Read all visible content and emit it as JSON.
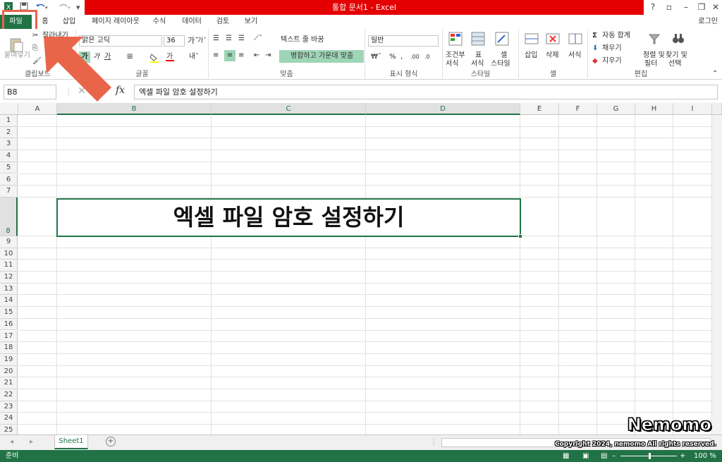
{
  "titlebar": {
    "title": "통합 문서1 - Excel",
    "qa_items": [
      "save-icon",
      "undo-icon",
      "redo-icon",
      "customize-icon"
    ]
  },
  "tabs": {
    "file": "파일",
    "home": "홈",
    "insert": "삽입",
    "layout": "페이지 레이아웃",
    "formulas": "수식",
    "data": "데이터",
    "review": "검토",
    "view": "보기",
    "login": "로그인"
  },
  "ribbon": {
    "clipboard": {
      "paste": "붙여넣기",
      "cut": "잘라내기",
      "label": "클립보드"
    },
    "font": {
      "name": "맑은 고딕",
      "size": "36",
      "label": "글꼴"
    },
    "align": {
      "wrap": "텍스트 줄 바꿈",
      "merge": "병합하고 가운데 맞춤",
      "label": "맞춤"
    },
    "number": {
      "format": "일반",
      "percent": "%",
      "comma": ",",
      "label": "표시 형식"
    },
    "styles": {
      "conditional1": "조건부",
      "conditional2": "서식",
      "table1": "표",
      "table2": "서식",
      "cell1": "셀",
      "cell2": "스타일",
      "label": "스타일"
    },
    "cells": {
      "insert": "삽입",
      "delete": "삭제",
      "format": "서식",
      "label": "셀"
    },
    "editing": {
      "autosum": "자동 합계",
      "fill": "채우기",
      "clear": "지우기",
      "sort1": "정렬 및",
      "sort2": "필터",
      "find1": "찾기 및",
      "find2": "선택",
      "label": "편집"
    }
  },
  "formula_bar": {
    "name_box": "B8",
    "fx": "fx",
    "content": "엑셀 파일 암호 설정하기"
  },
  "columns": [
    "A",
    "B",
    "C",
    "D",
    "E",
    "F",
    "G",
    "H",
    "I"
  ],
  "rows": [
    "1",
    "2",
    "3",
    "4",
    "5",
    "6",
    "7",
    "8",
    "9",
    "10",
    "11",
    "12",
    "13",
    "14",
    "15",
    "16",
    "17",
    "18",
    "19",
    "20",
    "21",
    "22",
    "23",
    "24",
    "25"
  ],
  "cell_b8": "엑셀 파일 암호 설정하기",
  "sheets": {
    "active": "Sheet1",
    "add": "+"
  },
  "status": {
    "left": "준비",
    "zoom": "100 %"
  },
  "watermark": {
    "brand": "Nemomo",
    "copyright": "Copyright 2024, nemomo All rights reserved."
  },
  "colors": {
    "accent": "#217346",
    "title_red": "#e40000",
    "highlight": "#e8654a"
  }
}
